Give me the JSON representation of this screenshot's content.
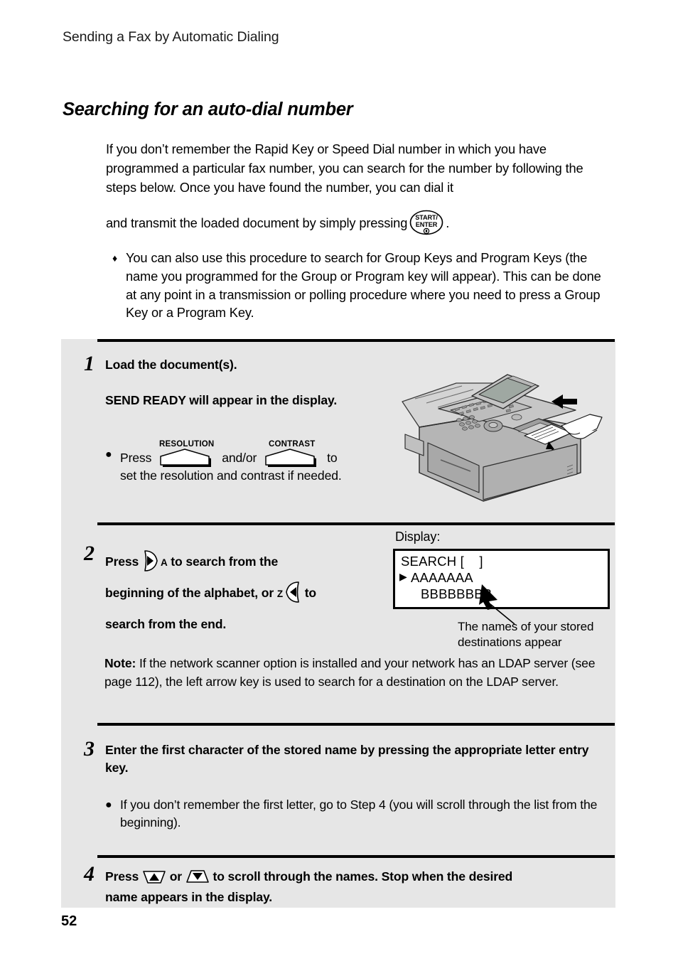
{
  "header": {
    "running_title": "Sending a Fax by Automatic Dialing"
  },
  "section": {
    "title": "Searching for an auto-dial number"
  },
  "intro": {
    "paragraph_1_before_key": "If you don’t remember the Rapid Key or Speed Dial number in which you have programmed a particular fax number, you can search for the number by following the steps below. Once you have found the number, you can dial it",
    "paragraph_2_before_key": "and transmit the loaded document by simply pressing",
    "paragraph_2_after_key": ".",
    "start_key_line_1": "START/",
    "start_key_line_2": "ENTER"
  },
  "diamond_note": {
    "bullet_glyph": "♦",
    "text": "You can also use this procedure to search for Group Keys and Program Keys (the name you programmed for the Group or Program key will appear). This can be done at any point in a transmission or polling procedure where you need to press a Group Key or a Program Key."
  },
  "steps": [
    {
      "number": "1",
      "line_1": "Load the document(s).",
      "line_2": "SEND READY will appear in the display.",
      "bullet_dot": "●",
      "bullet_before_key_1": "Press",
      "key_1_label": "RESOLUTION",
      "bullet_between_keys": "and/or",
      "key_2_label": "CONTRAST",
      "bullet_after_key_2": "to",
      "bullet_tail": "set the resolution and contrast if needed."
    },
    {
      "number": "2",
      "text_1": "Press",
      "key_right_letter": "A",
      "text_2": "to search from the",
      "text_3": "beginning of the alphabet, or",
      "key_left_letter": "Z",
      "text_4": "to",
      "text_5": "search from the end.",
      "note_label": "Note:",
      "note_text": " If the network scanner option is installed and your network has an LDAP server (see page 112), the left arrow key is used to search for a destination on the LDAP server."
    },
    {
      "number": "3",
      "line_1": "Enter the first character of the stored name by pressing the appropriate letter entry key.",
      "bullet_dot": "●",
      "bullet_text": "If you don’t remember the first letter, go to Step 4 (you will scroll through the list from the beginning)."
    },
    {
      "number": "4",
      "text_1": "Press",
      "text_2": "or",
      "text_3": "to scroll through the names. Stop when the desired",
      "text_4": "name appears in the display."
    }
  ],
  "display_callout": {
    "label": "Display:",
    "line_1": "SEARCH [    ]",
    "line_2_caret": "▶",
    "line_2": "AAAAAAA",
    "line_3": "BBBBBBBB",
    "callout_text": "The names of your stored destinations appear"
  },
  "footer": {
    "page_number": "52"
  },
  "colors": {
    "panel_background": "#e6e6e6",
    "page_background": "#ffffff",
    "rule": "#000000",
    "text": "#000000",
    "machine_body": "#b5b5b5",
    "machine_light": "#d0d0d0",
    "machine_dark": "#8a8a8a"
  }
}
